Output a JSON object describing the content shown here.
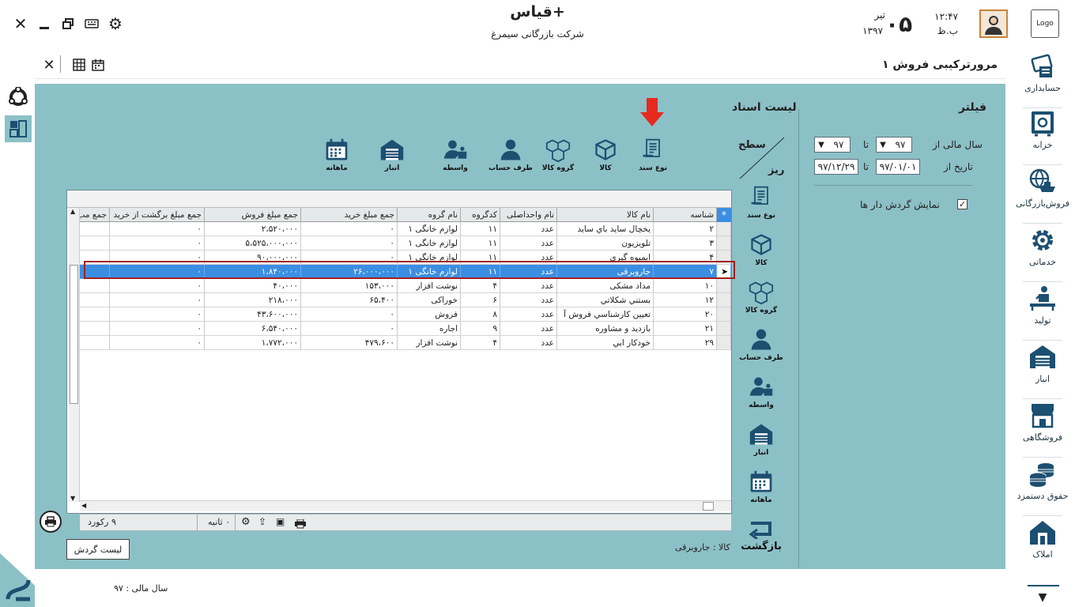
{
  "window": {
    "title": "قیاس+",
    "company": "شرکت بازرگانی سیمرغ",
    "time": "۱۲:۴۷",
    "ampm": "ب.ظ",
    "day": "۰۵",
    "month": "تیر",
    "year": "۱۳۹۷",
    "logo": "Logo"
  },
  "subbar": {
    "page_title": "مرورترکیبی فروش ۱"
  },
  "sidebar": {
    "items": [
      {
        "label": "حسابداری",
        "icon": "accounting-icon"
      },
      {
        "label": "خزانه",
        "icon": "safe-icon"
      },
      {
        "label": "فروش‌بازرگانی",
        "icon": "globe-trade-icon"
      },
      {
        "label": "خدماتی",
        "icon": "gear-service-icon"
      },
      {
        "label": "تولید",
        "icon": "worker-icon"
      },
      {
        "label": "انبار",
        "icon": "warehouse-icon"
      },
      {
        "label": "فروشگاهی",
        "icon": "store-icon"
      },
      {
        "label": "حقوق دستمزد",
        "icon": "coins-icon"
      },
      {
        "label": "املاک",
        "icon": "house-icon"
      }
    ]
  },
  "filter": {
    "title": "فیلتر",
    "fiscal_from_label": "سال مالی از",
    "fiscal_from": "۹۷",
    "to_label": "تا",
    "fiscal_to": "۹۷",
    "date_from_label": "تاریخ از",
    "date_from": "۹۷/۰۱/۰۱",
    "date_to": "۹۷/۱۲/۲۹",
    "show_turnover_label": "نمایش گردش دار ها",
    "show_turnover": true
  },
  "docs": {
    "title": "لیست اسناد",
    "level_top": "سطح",
    "level_bottom": "ریز"
  },
  "toolbar": {
    "items": [
      {
        "label": "نوع سند",
        "icon": "doc-type-icon"
      },
      {
        "label": "کالا",
        "icon": "box-icon"
      },
      {
        "label": "گروه کالا",
        "icon": "box-group-icon"
      },
      {
        "label": "طرف حساب",
        "icon": "person-icon"
      },
      {
        "label": "واسطه",
        "icon": "agent-icon"
      },
      {
        "label": "انبار",
        "icon": "warehouse-icon"
      },
      {
        "label": "ماهانه",
        "icon": "calendar-icon"
      }
    ]
  },
  "side_tools": {
    "items": [
      {
        "label": "نوع سند",
        "icon": "doc-type-icon"
      },
      {
        "label": "کالا",
        "icon": "box-icon"
      },
      {
        "label": "گروه کالا",
        "icon": "box-group-icon"
      },
      {
        "label": "طرف حساب",
        "icon": "person-icon"
      },
      {
        "label": "واسطه",
        "icon": "agent-icon"
      },
      {
        "label": "انبار",
        "icon": "warehouse-icon"
      },
      {
        "label": "ماهانه",
        "icon": "calendar-icon"
      }
    ],
    "back": "بازگشت"
  },
  "grid": {
    "columns": [
      "شناسه",
      "نام کالا",
      "نام واحداصلی",
      "کدگروه",
      "نام گروه",
      "جمع مبلغ خرید",
      "جمع مبلغ فروش",
      "جمع مبلغ برگشت از خرید",
      "جمع مب"
    ],
    "rows": [
      [
        "۲",
        "يخچال ساید باي ساید",
        "عدد",
        "۱۱",
        "لوازم خانگی ۱",
        "۰",
        "۲،۵۲۰،۰۰۰",
        "۰",
        ""
      ],
      [
        "۳",
        "تلویزیون",
        "عدد",
        "۱۱",
        "لوازم خانگی ۱",
        "۰",
        "۵،۵۲۵،۰۰۰،۰۰۰",
        "۰",
        ""
      ],
      [
        "۴",
        "ابمیوه گیري",
        "عدد",
        "۱۱",
        "لوازم خانگی ۱",
        "۰",
        "۹۰،۰۰۰،۰۰۰",
        "۰",
        ""
      ],
      [
        "۷",
        "جاروبرقی",
        "عدد",
        "۱۱",
        "لوازم خانگی ۱",
        "۲۶،۰۰۰،۰۰۰",
        "۱،۸۴۰،۰۰۰",
        "۰",
        ""
      ],
      [
        "۱۰",
        "مداد مشکی",
        "عدد",
        "۴",
        "نوشت افزار",
        "۱۵۳،۰۰۰",
        "۴۰،۰۰۰",
        "۰",
        ""
      ],
      [
        "۱۲",
        "بستني شکلاتي",
        "عدد",
        "۶",
        "خوراکی",
        "۶۵،۴۰۰",
        "۲۱۸،۰۰۰",
        "۰",
        ""
      ],
      [
        "۲۰",
        "تعیین کارشناسي فروش آ",
        "عدد",
        "۸",
        "فروش",
        "۰",
        "۴۳،۶۰۰،۰۰۰",
        "۰",
        ""
      ],
      [
        "۲۱",
        "بازدید و مشاوره",
        "عدد",
        "۹",
        "اجاره",
        "۰",
        "۶،۵۴۰،۰۰۰",
        "۰",
        ""
      ],
      [
        "۲۹",
        "خودکار ابي",
        "عدد",
        "۴",
        "نوشت افزار",
        "۴۷۹،۶۰۰",
        "۱،۷۷۲،۰۰۰",
        "۰",
        ""
      ]
    ],
    "selected_row": 3
  },
  "status": {
    "records": "۹ رکورد",
    "seconds": "۰ ثانیه"
  },
  "footer": {
    "goods_label": "کالا : جاروبرقی",
    "turnover_button": "لیست گردش",
    "fiscal_year": "سال مالی : ۹۷"
  }
}
